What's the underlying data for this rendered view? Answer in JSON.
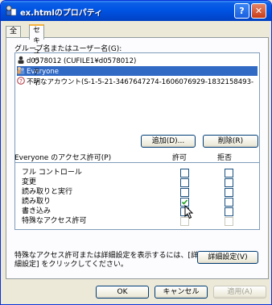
{
  "window": {
    "title": "ex.htmlのプロパティ",
    "help_label": "?",
    "close_label": "✕"
  },
  "tabs": [
    {
      "label": "全般",
      "active": false
    },
    {
      "label": "セキュリティ",
      "active": true
    }
  ],
  "groups_label": "グループ名またはユーザー名(G):",
  "principals": [
    {
      "name": "d0578012 (CUFILE1¥d0578012)",
      "icon": "user-icon",
      "selected": false
    },
    {
      "name": "Everyone",
      "icon": "group-icon",
      "selected": true
    },
    {
      "name": "不明なアカウント(S-1-5-21-3467647274-1606076929-1832158493-",
      "icon": "unknown-account-icon",
      "selected": false
    }
  ],
  "add_button": "追加(D)...",
  "remove_button": "削除(R)",
  "permissions_header": {
    "label": "Everyone のアクセス許可(P)",
    "allow": "許可",
    "deny": "拒否"
  },
  "permissions": [
    {
      "name": "フル コントロール",
      "allow": false,
      "deny": false,
      "disabled": false
    },
    {
      "name": "変更",
      "allow": false,
      "deny": false,
      "disabled": false
    },
    {
      "name": "読み取りと実行",
      "allow": false,
      "deny": false,
      "disabled": false
    },
    {
      "name": "読み取り",
      "allow": true,
      "deny": false,
      "disabled": false
    },
    {
      "name": "書き込み",
      "allow": false,
      "deny": false,
      "disabled": false
    },
    {
      "name": "特殊なアクセス許可",
      "allow": false,
      "deny": false,
      "disabled": true
    }
  ],
  "advanced_note_line1": "特殊なアクセス許可または詳細設定を表示するには、[詳",
  "advanced_note_line2": "細設定] をクリックしてください。",
  "advanced_button": "詳細設定(V)",
  "ok_button": "OK",
  "cancel_button": "キャンセル",
  "apply_button": "適用(A)",
  "colors": {
    "selection": "#316ac5",
    "titlebar": "#0054e3"
  }
}
